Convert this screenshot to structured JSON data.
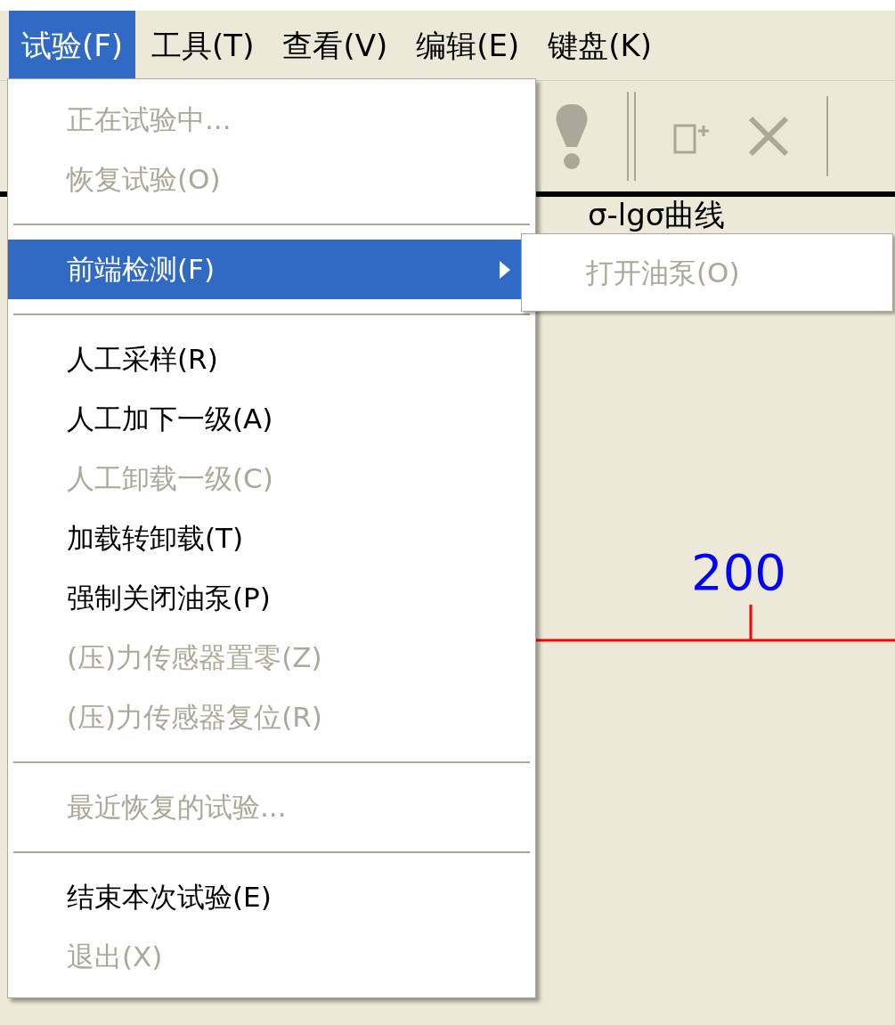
{
  "menu_bar": [
    {
      "label": "试验(F)",
      "selected": true
    },
    {
      "label": "工具(T)",
      "selected": false
    },
    {
      "label": "查看(V)",
      "selected": false
    },
    {
      "label": "编辑(E)",
      "selected": false
    },
    {
      "label": "键盘(K)",
      "selected": false
    }
  ],
  "tabs": [
    {
      "label": "σ-lgσ曲线"
    }
  ],
  "chart": {
    "label": "200"
  },
  "menu": {
    "items": [
      {
        "kind": "item",
        "label": "正在试验中...",
        "disabled": true,
        "selected": false
      },
      {
        "kind": "item",
        "label": "恢复试验(O)",
        "disabled": true,
        "selected": false
      },
      {
        "kind": "separator"
      },
      {
        "kind": "submenu",
        "label": "前端检测(F)",
        "disabled": false,
        "selected": true
      },
      {
        "kind": "separator"
      },
      {
        "kind": "item",
        "label": "人工采样(R)",
        "disabled": false,
        "selected": false
      },
      {
        "kind": "item",
        "label": "人工加下一级(A)",
        "disabled": false,
        "selected": false
      },
      {
        "kind": "item",
        "label": "人工卸载一级(C)",
        "disabled": true,
        "selected": false
      },
      {
        "kind": "item",
        "label": "加载转卸载(T)",
        "disabled": false,
        "selected": false
      },
      {
        "kind": "item",
        "label": "强制关闭油泵(P)",
        "disabled": false,
        "selected": false
      },
      {
        "kind": "item",
        "label": "(压)力传感器置零(Z)",
        "disabled": true,
        "selected": false
      },
      {
        "kind": "item",
        "label": "(压)力传感器复位(R)",
        "disabled": true,
        "selected": false
      },
      {
        "kind": "separator"
      },
      {
        "kind": "item",
        "label": "最近恢复的试验...",
        "disabled": true,
        "selected": false
      },
      {
        "kind": "separator"
      },
      {
        "kind": "item",
        "label": "结束本次试验(E)",
        "disabled": false,
        "selected": false
      },
      {
        "kind": "item",
        "label": "退出(X)",
        "disabled": true,
        "selected": false
      }
    ]
  },
  "submenu": {
    "items": [
      {
        "label": "打开油泵(O)",
        "disabled": true
      }
    ]
  }
}
